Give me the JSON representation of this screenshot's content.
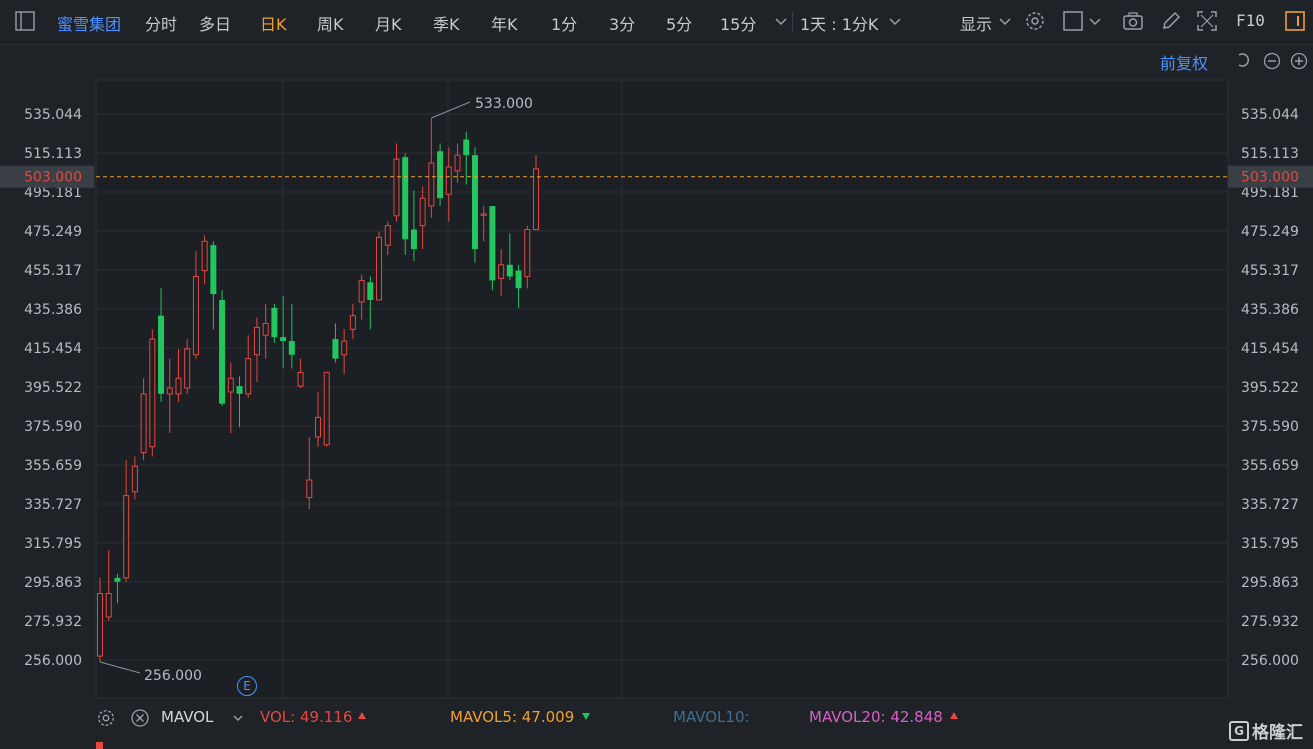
{
  "toolbar": {
    "stock_name": "蜜雪集团",
    "periods": [
      "分时",
      "多日",
      "日K",
      "周K",
      "月K",
      "季K",
      "年K",
      "1分",
      "3分",
      "5分",
      "15分"
    ],
    "active_period": "日K",
    "range": "1天 : 1分K",
    "display": "显示",
    "f10": "F10"
  },
  "fuquan": "前复权",
  "price_axis": {
    "ticks": [
      "535.044",
      "515.113",
      "495.181",
      "475.249",
      "455.317",
      "435.386",
      "415.454",
      "395.522",
      "375.590",
      "355.659",
      "335.727",
      "315.795",
      "295.863",
      "275.932",
      "256.000"
    ],
    "current": "503.000",
    "high_label": "533.000",
    "low_label": "256.000"
  },
  "event_marker": "E",
  "volume": {
    "indicator": "MAVOL",
    "vol": "VOL: 49.116",
    "mavol5": "MAVOL5: 47.009",
    "mavol10": "MAVOL10:",
    "mavol20": "MAVOL20: 42.848"
  },
  "colors": {
    "up": "#e5483f",
    "down": "#22c55e",
    "accent": "#f0a030",
    "link": "#4c92ff"
  },
  "logo": "格隆汇",
  "chart_data": {
    "type": "candlestick",
    "ylim": [
      256.0,
      535.044
    ],
    "candles": [
      {
        "o": 258,
        "c": 290,
        "h": 298,
        "l": 255
      },
      {
        "o": 278,
        "c": 290,
        "h": 312,
        "l": 276
      },
      {
        "o": 298,
        "c": 296,
        "h": 300,
        "l": 285
      },
      {
        "o": 298,
        "c": 340,
        "h": 358,
        "l": 296
      },
      {
        "o": 342,
        "c": 355,
        "h": 360,
        "l": 338
      },
      {
        "o": 362,
        "c": 392,
        "h": 400,
        "l": 358
      },
      {
        "o": 365,
        "c": 420,
        "h": 425,
        "l": 360
      },
      {
        "o": 432,
        "c": 392,
        "h": 446,
        "l": 388
      },
      {
        "o": 392,
        "c": 395,
        "h": 410,
        "l": 372
      },
      {
        "o": 392,
        "c": 400,
        "h": 415,
        "l": 388
      },
      {
        "o": 395,
        "c": 415,
        "h": 420,
        "l": 392
      },
      {
        "o": 412,
        "c": 452,
        "h": 465,
        "l": 410
      },
      {
        "o": 455,
        "c": 470,
        "h": 473,
        "l": 448
      },
      {
        "o": 468,
        "c": 443,
        "h": 470,
        "l": 425
      },
      {
        "o": 440,
        "c": 387,
        "h": 445,
        "l": 386
      },
      {
        "o": 393,
        "c": 400,
        "h": 408,
        "l": 372
      },
      {
        "o": 396,
        "c": 392,
        "h": 401,
        "l": 375
      },
      {
        "o": 392,
        "c": 410,
        "h": 422,
        "l": 390
      },
      {
        "o": 412,
        "c": 426,
        "h": 431,
        "l": 398
      },
      {
        "o": 422,
        "c": 428,
        "h": 438,
        "l": 410
      },
      {
        "o": 436,
        "c": 421,
        "h": 438,
        "l": 418
      },
      {
        "o": 421,
        "c": 419,
        "h": 442,
        "l": 405
      },
      {
        "o": 419,
        "c": 412,
        "h": 438,
        "l": 405
      },
      {
        "o": 396,
        "c": 403,
        "h": 410,
        "l": 395
      },
      {
        "o": 339,
        "c": 348,
        "h": 370,
        "l": 333
      },
      {
        "o": 370,
        "c": 380,
        "h": 393,
        "l": 365
      },
      {
        "o": 366,
        "c": 403,
        "h": 403,
        "l": 365
      },
      {
        "o": 420,
        "c": 410,
        "h": 428,
        "l": 408
      },
      {
        "o": 412,
        "c": 419,
        "h": 425,
        "l": 402
      },
      {
        "o": 425,
        "c": 432,
        "h": 438,
        "l": 420
      },
      {
        "o": 439,
        "c": 450,
        "h": 453,
        "l": 430
      },
      {
        "o": 449,
        "c": 440,
        "h": 452,
        "l": 425
      },
      {
        "o": 440,
        "c": 472,
        "h": 475,
        "l": 440
      },
      {
        "o": 468,
        "c": 478,
        "h": 480,
        "l": 463
      },
      {
        "o": 483,
        "c": 512,
        "h": 520,
        "l": 480
      },
      {
        "o": 513,
        "c": 471,
        "h": 515,
        "l": 463
      },
      {
        "o": 476,
        "c": 466,
        "h": 496,
        "l": 460
      },
      {
        "o": 478,
        "c": 492,
        "h": 498,
        "l": 466
      },
      {
        "o": 488,
        "c": 510,
        "h": 533,
        "l": 482
      },
      {
        "o": 516,
        "c": 492,
        "h": 520,
        "l": 488
      },
      {
        "o": 494,
        "c": 508,
        "h": 518,
        "l": 480
      },
      {
        "o": 506,
        "c": 514,
        "h": 520,
        "l": 500
      },
      {
        "o": 522,
        "c": 514,
        "h": 526,
        "l": 499
      },
      {
        "o": 514,
        "c": 466,
        "h": 518,
        "l": 459
      },
      {
        "o": 484,
        "c": 484,
        "h": 488,
        "l": 470
      },
      {
        "o": 488,
        "c": 450,
        "h": 488,
        "l": 445
      },
      {
        "o": 451,
        "c": 458,
        "h": 466,
        "l": 442
      },
      {
        "o": 458,
        "c": 452,
        "h": 474,
        "l": 450
      },
      {
        "o": 455,
        "c": 446,
        "h": 458,
        "l": 436
      },
      {
        "o": 452,
        "c": 476,
        "h": 478,
        "l": 446
      },
      {
        "o": 476,
        "c": 507,
        "h": 514,
        "l": 476
      }
    ]
  }
}
